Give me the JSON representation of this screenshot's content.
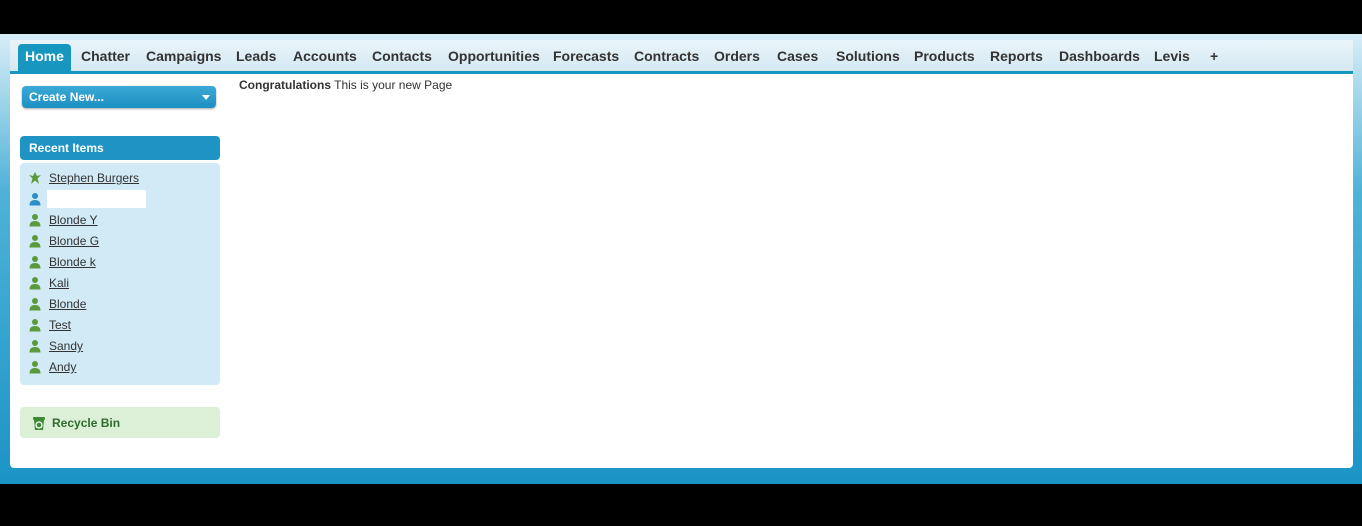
{
  "tabs": [
    {
      "label": "Home",
      "active": true
    },
    {
      "label": "Chatter"
    },
    {
      "label": "Campaigns"
    },
    {
      "label": "Leads"
    },
    {
      "label": "Accounts"
    },
    {
      "label": "Contacts"
    },
    {
      "label": "Opportunities"
    },
    {
      "label": "Forecasts"
    },
    {
      "label": "Contracts"
    },
    {
      "label": "Orders"
    },
    {
      "label": "Cases"
    },
    {
      "label": "Solutions"
    },
    {
      "label": "Products"
    },
    {
      "label": "Reports"
    },
    {
      "label": "Dashboards"
    },
    {
      "label": "Levis"
    },
    {
      "label": "+",
      "icon": "plus-icon"
    }
  ],
  "sidebar": {
    "create_new_label": "Create New...",
    "recent_items_header": "Recent Items",
    "recent_items": [
      {
        "label": "Stephen Burgers",
        "icon": "lead-icon"
      },
      {
        "label": "",
        "icon": "user-icon"
      },
      {
        "label": "Blonde Y",
        "icon": "contact-icon"
      },
      {
        "label": "Blonde G",
        "icon": "contact-icon"
      },
      {
        "label": "Blonde k",
        "icon": "contact-icon"
      },
      {
        "label": "Kali",
        "icon": "contact-icon"
      },
      {
        "label": "Blonde",
        "icon": "contact-icon"
      },
      {
        "label": "Test",
        "icon": "contact-icon"
      },
      {
        "label": "Sandy",
        "icon": "contact-icon"
      },
      {
        "label": "Andy",
        "icon": "contact-icon"
      }
    ],
    "recycle_bin_label": "Recycle Bin"
  },
  "main": {
    "message_bold": "Congratulations",
    "message_text": "This is your new Page"
  },
  "colors": {
    "accent": "#1797c0",
    "recent_bg": "#d1eaf6",
    "recycle_bg": "#dcefd7",
    "contact_icon": "#5b9a3a",
    "user_icon": "#2a8fc8"
  }
}
